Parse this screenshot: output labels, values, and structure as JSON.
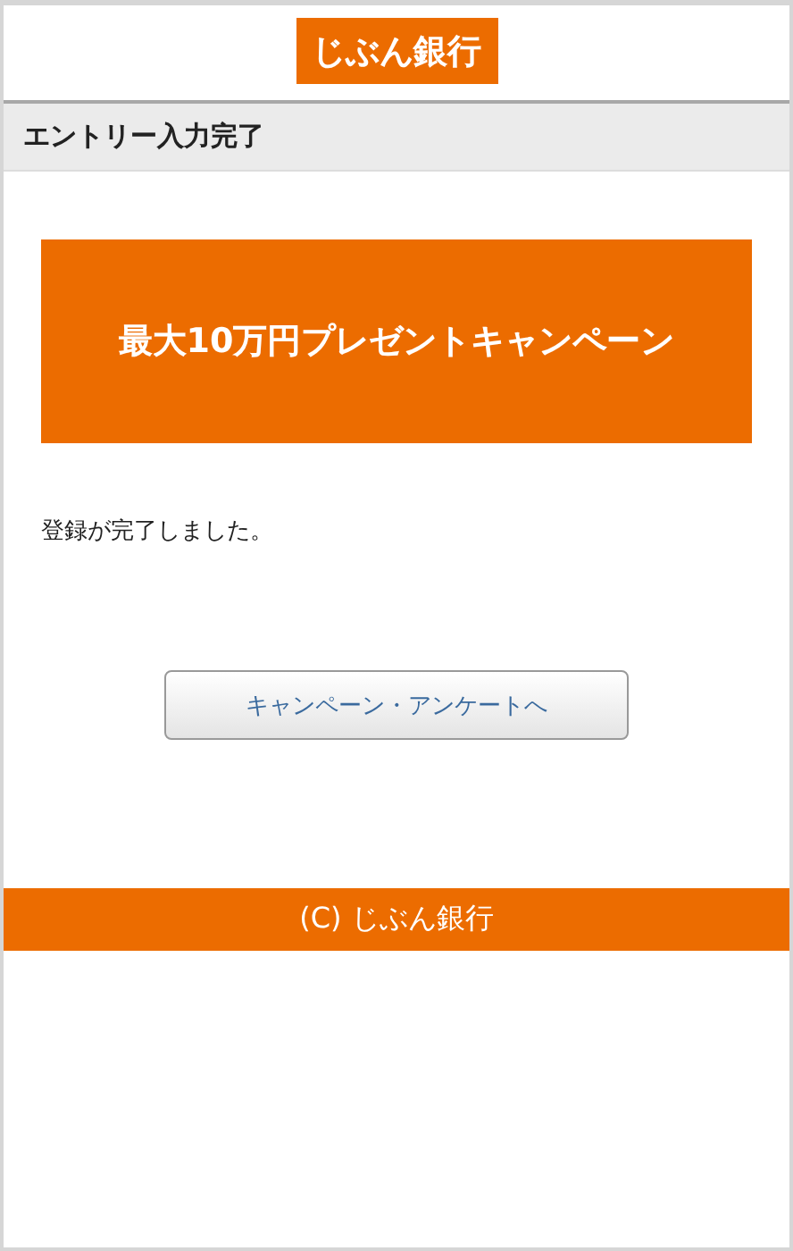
{
  "header": {
    "logo": "じぶん銀行"
  },
  "page_title": "エントリー入力完了",
  "banner": {
    "text": "最大10万円プレゼントキャンペーン"
  },
  "message": "登録が完了しました。",
  "buttons": [
    {
      "label": "キャンペーン・アンケートへ"
    }
  ],
  "footer": {
    "copyright": "(C) じぶん銀行"
  }
}
